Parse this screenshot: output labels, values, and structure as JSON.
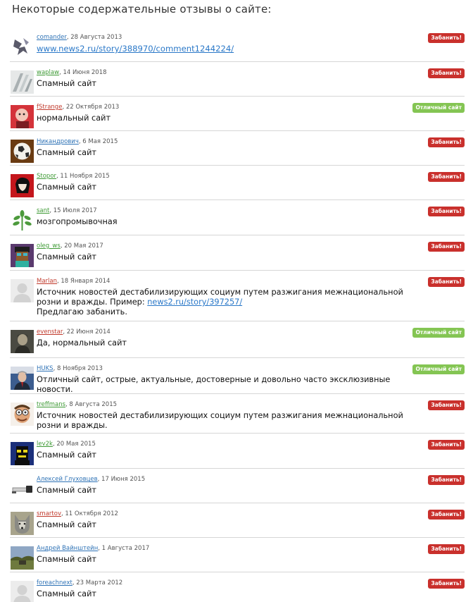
{
  "header": {
    "title": "Некоторые содержательные отзывы о сайте:"
  },
  "badges": {
    "ban": "Забанить!",
    "ok": "Отличный сайт"
  },
  "reviews": [
    {
      "user": "comander",
      "date": ", 28 Августа 2013",
      "text_link": "www.news2.ru/story/388970/comment1244224/"
    },
    {
      "user": "waplaw",
      "date": ", 14 Июня 2018",
      "text": "Спамный сайт"
    },
    {
      "user": "fStrange",
      "date": ", 22 Октября 2013",
      "text": "нормальный сайт"
    },
    {
      "user": "Никандрович",
      "date": ", 6 Мая 2015",
      "text": "Спамный сайт"
    },
    {
      "user": "Stopor",
      "date": ", 11 Ноября 2015",
      "text": "Спамный сайт"
    },
    {
      "user": "sant",
      "date": ", 15 Июля 2017",
      "text": "мозгопромывочная"
    },
    {
      "user": "oleg_ws",
      "date": ", 20 Мая 2017",
      "text": "Спамный сайт"
    },
    {
      "user": "Marlan",
      "date": ", 18 Января 2014",
      "text_part1": "Источник новостей дестабилизирующих социум путем разжигания межнациональной розни и вражды. Пример: ",
      "text_link": "news2.ru/story/397257/",
      "text_part2": "Предлагаю забанить."
    },
    {
      "user": "evenstar",
      "date": ", 22 Июня 2014",
      "text": "Да, нормальный сайт"
    },
    {
      "user": "HUKS",
      "date": ", 8 Ноября 2013",
      "text": "Отличный сайт, острые, актуальные, достоверные и довольно часто эксклюзивные новости."
    },
    {
      "user": "treffmans",
      "date": ", 8 Августа 2015",
      "text": "Источник новостей дестабилизирующих социум путем разжигания межнациональной розни и вражды."
    },
    {
      "user": "lev2k",
      "date": ", 20 Мая 2015",
      "text": "Спамный сайт"
    },
    {
      "user": "Алексей Глуховцев",
      "date": ", 17 Июня 2015",
      "text": "Спамный сайт"
    },
    {
      "user": "smartov",
      "date": ", 11 Октября 2012",
      "text": "Спамный сайт"
    },
    {
      "user": "Андрей Вайнштейн",
      "date": ", 1 Августа 2017",
      "text": "Спамный сайт"
    },
    {
      "user": "foreachnext",
      "date": ", 23 Марта 2012",
      "text": "Спамный сайт"
    }
  ]
}
